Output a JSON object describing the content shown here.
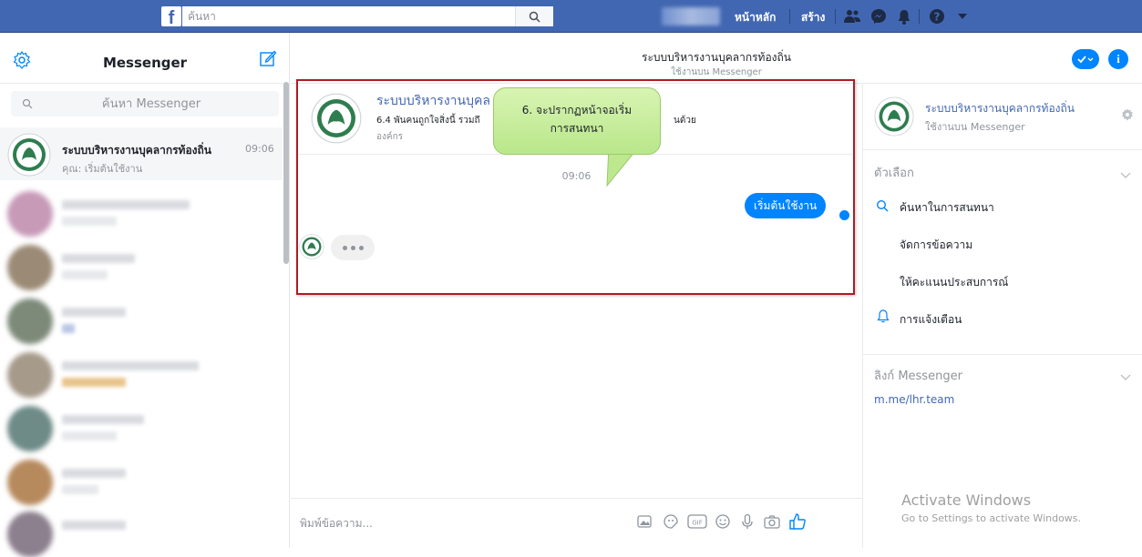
{
  "topbar": {
    "logo_letter": "f",
    "search_placeholder": "ค้นหา",
    "nav_home": "หน้าหลัก",
    "nav_create": "สร้าง"
  },
  "sidebar": {
    "title": "Messenger",
    "search_placeholder": "ค้นหา Messenger",
    "active_conversation": {
      "name": "ระบบบริหารงานบุคลากรท้องถิ่น",
      "time": "09:06",
      "preview": "คุณ: เริ่มต้นใช้งาน"
    }
  },
  "chat_header": {
    "title": "ระบบบริหารงานบุคลากรท้องถิ่น",
    "subtitle": "ใช้งานบน Messenger"
  },
  "page_card": {
    "name": "ระบบบริหารงานบุคล",
    "description": "6.4 พันคนถูกใจสิ่งนี้ รวมถึ",
    "description_end": "นด้วย",
    "category": "องค์กร"
  },
  "messages": {
    "time": "09:06",
    "outgoing": "เริ่มต้นใช้งาน"
  },
  "callout": {
    "line1": "6. จะปรากฏหน้าจอเริ่ม",
    "line2": "การสนทนา"
  },
  "composer": {
    "placeholder": "พิมพ์ข้อความ..."
  },
  "right_panel": {
    "name": "ระบบบริหารงานบุคลากรท้องถิ่น",
    "subtitle": "ใช้งานบน Messenger",
    "options_title": "ตัวเลือก",
    "options": [
      "ค้นหาในการสนทนา",
      "จัดการข้อความ",
      "ให้คะแนนประสบการณ์",
      "การแจ้งเตือน"
    ],
    "link_title": "ลิงก์ Messenger",
    "link": "m.me/lhr.team"
  },
  "watermark": {
    "line1": "Activate Windows",
    "line2": "Go to Settings to activate Windows."
  },
  "colors": {
    "facebook_blue": "#4267b2",
    "messenger_blue": "#0084ff",
    "highlight_red": "#b01c25",
    "callout_green": "#c6ec9c"
  }
}
